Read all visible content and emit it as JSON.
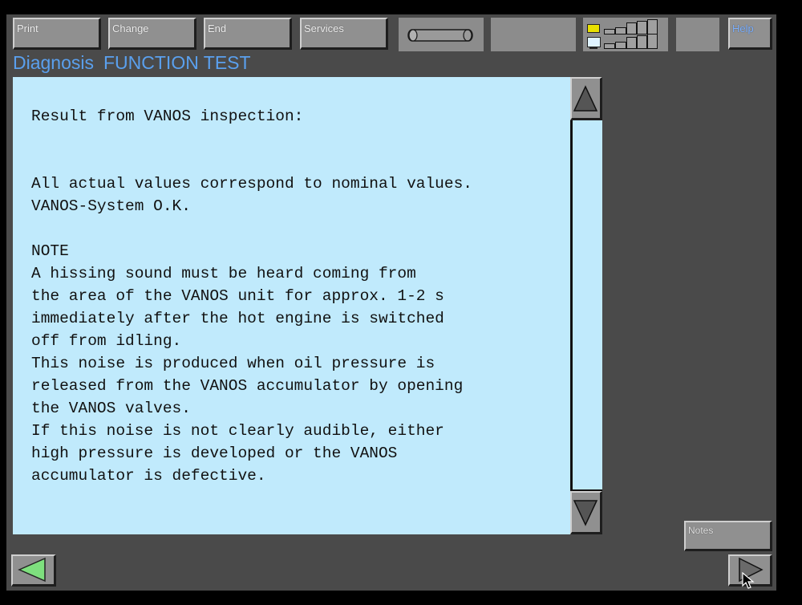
{
  "toolbar": {
    "print_label": "Print",
    "change_label": "Change",
    "end_label": "End",
    "services_label": "Services",
    "help_label": "Help"
  },
  "status_icons": [
    "chip-icon",
    "monitor-icon",
    "signal-bars-icon"
  ],
  "header": {
    "section": "Diagnosis",
    "function": "FUNCTION TEST"
  },
  "content": {
    "heading": "Result from VANOS inspection:",
    "result_lines": [
      "All actual values correspond to nominal values.",
      "VANOS-System O.K."
    ],
    "note_title": "NOTE",
    "note_lines": [
      "A hissing sound must be heard coming from",
      "the area of the VANOS unit for approx. 1-2 s",
      "immediately after the hot engine is switched",
      "off from idling.",
      "This noise is produced when oil pressure is",
      "released from the VANOS accumulator by opening",
      "the VANOS valves.",
      "If this noise is not clearly audible, either",
      "high pressure is developed or the VANOS",
      "accumulator is defective."
    ]
  },
  "footer": {
    "notes_label": "Notes"
  },
  "colors": {
    "background": "#4a4a4a",
    "content_bg": "#c0eafc",
    "title_blue": "#5aa0ee",
    "back_arrow_green": "#7ee07e"
  }
}
